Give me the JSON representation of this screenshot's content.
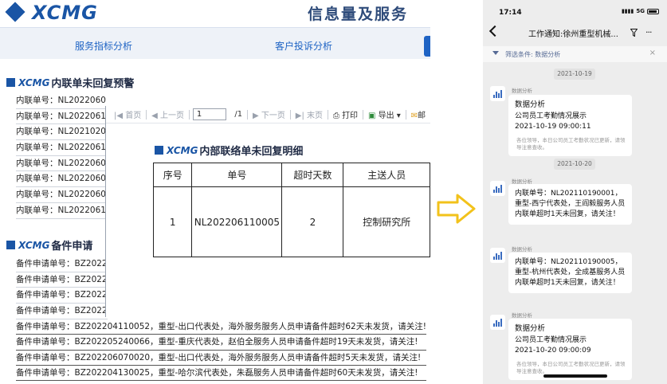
{
  "desktop": {
    "logo_text": "XCMG",
    "slogan": "信息量及服务",
    "tabs": [
      "服务指标分析",
      "客户投诉分析"
    ],
    "section1": {
      "logo": "XCMG",
      "title": "内联单未回复预警",
      "rows": [
        "内联单号：NL2022060",
        "内联单号：NL2022061",
        "内联单号：NL2021020",
        "内联单号：NL2022061",
        "内联单号：NL2022060",
        "内联单号：NL2022060",
        "内联单号：NL2022060",
        "内联单号：NL2022061"
      ]
    },
    "section2": {
      "logo": "XCMG",
      "title": "备件申请",
      "rows": [
        "备件申请单号：BZ2022",
        "备件申请单号：BZ2022",
        "备件申请单号：BZ2022",
        "备件申请单号：BZ2022"
      ],
      "full_rows": [
        "备件申请单号：BZ202204110052，重型-出口代表处，海外服务服务人员申请备件超时62天未发货，请关注!",
        "备件申请单号：BZ202205240066，重型-重庆代表处，赵伯全服务人员申请备件超时19天未发货，请关注!",
        "备件申请单号：BZ202206070020，重型-出口代表处，海外服务服务人员申请备件超时5天未发货，请关注!",
        "备件申请单号：BZ202204130025，重型-哈尔滨代表处，朱磊服务人员申请备件超时60天未发货，请关注!"
      ]
    },
    "report": {
      "toolbar": {
        "first": "首页",
        "prev": "上一页",
        "page_value": "1",
        "page_total": "/1",
        "next": "下一页",
        "last": "末页",
        "print": "打印",
        "export": "导出",
        "mail": "邮"
      },
      "logo": "XCMG",
      "title": "内部联络单未回复明细",
      "headers": [
        "序号",
        "单号",
        "超时天数",
        "主送人员"
      ],
      "row": [
        "1",
        "NL202206110005",
        "2",
        "控制研究所"
      ]
    }
  },
  "phone": {
    "time": "17:14",
    "network": "5G",
    "title": "工作通知:徐州重型机械...",
    "filter_text": "筛选条件: 数据分析",
    "messages": [
      {
        "date": "2021-10-19",
        "sender": "数据分析",
        "title": "数据分析",
        "body": "公司员工考勤情况展示\n2021-10-19 09:00:11",
        "note": "各位领导，本日公司员工考勤状况已更新，请领导注意查收。"
      },
      {
        "date": "2021-10-20",
        "sender": "数据分析",
        "body": "内联单号：NL202110190001，重型-西宁代表处，王阎毅服务人员内联单超时1天未回复，请关注！"
      },
      {
        "sender": "数据分析",
        "body": "内联单号：NL202110190005，重型-杭州代表处，全成基服务人员内联单超时1天未回复，请关注！"
      },
      {
        "sender": "数据分析",
        "title": "数据分析",
        "body": "公司员工考勤情况展示\n2021-10-20 09:00:09",
        "note": "各位领导，本日公司员工考勤状况已更新，请领导注意查收。"
      }
    ]
  },
  "colors": {
    "brand_blue": "#1a55a5",
    "link_blue": "#1e63c4",
    "arrow_yellow": "#f2c21b"
  }
}
